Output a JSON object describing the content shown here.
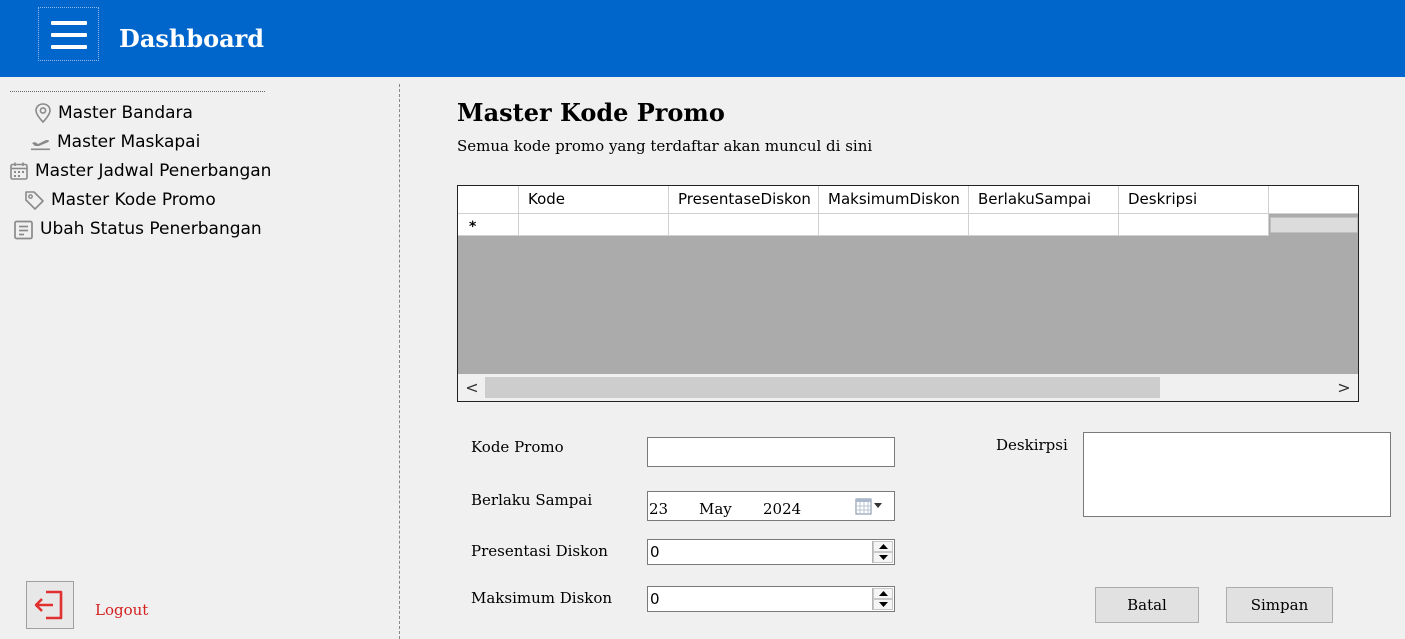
{
  "header": {
    "title": "Dashboard",
    "menu_icon": "hamburger-menu-icon"
  },
  "sidebar": {
    "items": [
      {
        "label": "Master Bandara",
        "icon": "location-pin-icon"
      },
      {
        "label": "Master Maskapai",
        "icon": "airplane-takeoff-icon"
      },
      {
        "label": "Master Jadwal Penerbangan",
        "icon": "calendar-icon"
      },
      {
        "label": "Master Kode Promo",
        "icon": "tag-icon"
      },
      {
        "label": "Ubah Status Penerbangan",
        "icon": "clipboard-icon"
      }
    ],
    "logout_label": "Logout"
  },
  "main": {
    "title": "Master Kode Promo",
    "subtitle": "Semua kode promo yang terdaftar akan muncul di sini",
    "grid": {
      "columns": [
        "Kode",
        "PresentaseDiskon",
        "MaksimumDiskon",
        "BerlakuSampai",
        "Deskripsi"
      ],
      "new_row_marker": "*",
      "scroll_left": "<",
      "scroll_right": ">"
    },
    "form": {
      "kode_promo_label": "Kode Promo",
      "kode_promo_value": "",
      "berlaku_sampai_label": "Berlaku Sampai",
      "date_day": "23",
      "date_month": "May",
      "date_year": "2024",
      "presentasi_diskon_label": "Presentasi Diskon",
      "presentasi_diskon_value": "0",
      "maksimum_diskon_label": "Maksimum Diskon",
      "maksimum_diskon_value": "0",
      "deskripsi_label": "Deskirpsi",
      "deskripsi_value": ""
    },
    "buttons": {
      "batal": "Batal",
      "simpan": "Simpan"
    }
  },
  "colors": {
    "header_bg": "#0066cc",
    "logout_red": "#d32020",
    "grid_bg": "#ababab"
  }
}
